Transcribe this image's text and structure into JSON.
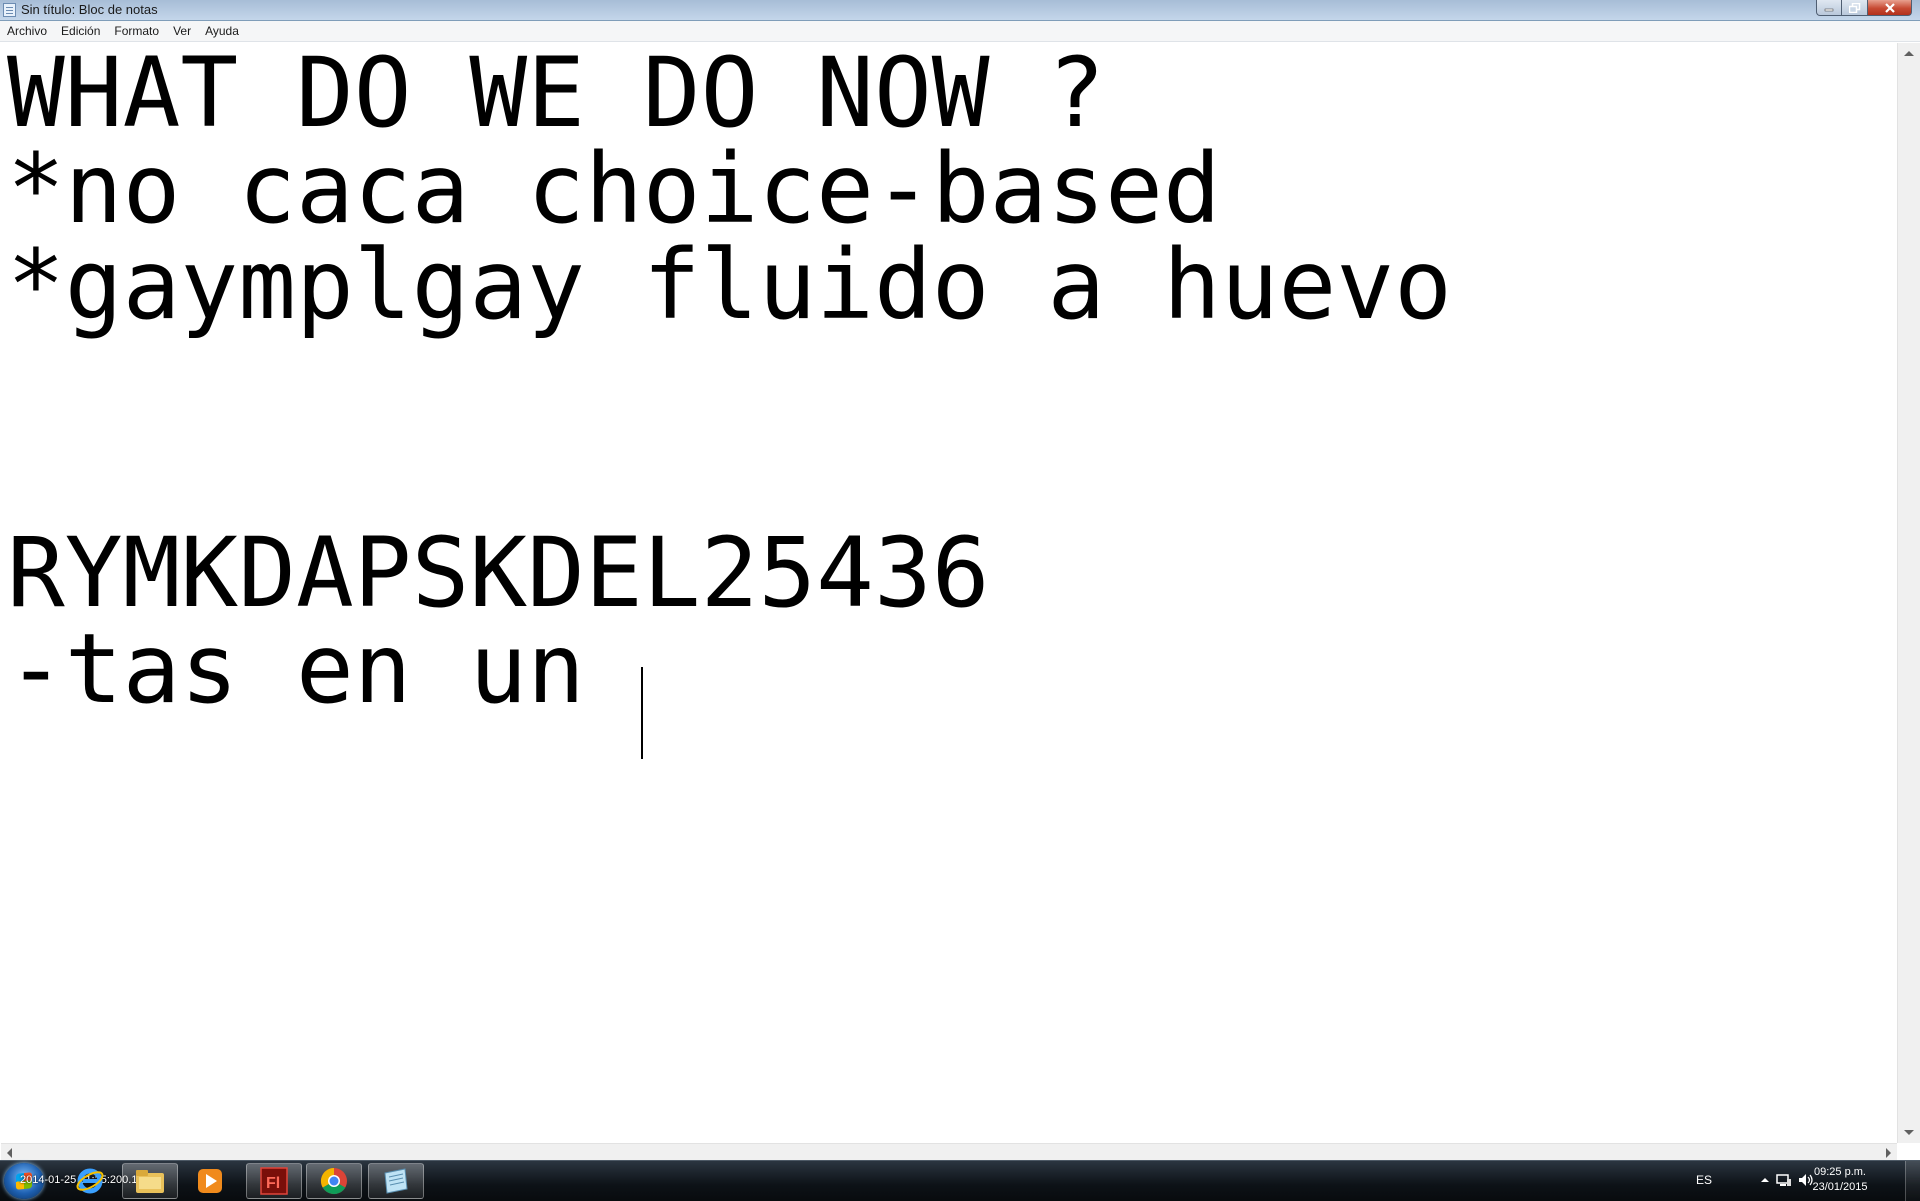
{
  "window": {
    "title": "Sin título: Bloc de notas"
  },
  "menu": [
    "Archivo",
    "Edición",
    "Formato",
    "Ver",
    "Ayuda"
  ],
  "document": {
    "lines": [
      "WHAT DO WE DO NOW ?",
      "*no caca choice-based",
      "*gaymplgay fluido a huevo",
      "",
      "",
      "RYMKDAPSKDEL25436",
      "-tas en un "
    ]
  },
  "taskbar": {
    "overlay_text": "2014-01-25 21:25:200.14",
    "pinned": [
      {
        "name": "Internet Explorer",
        "icon": "internet-explorer-icon"
      },
      {
        "name": "Windows Explorer",
        "icon": "folder-icon"
      },
      {
        "name": "Windows Media Player",
        "icon": "media-player-icon"
      },
      {
        "name": "Flash",
        "icon": "flash-icon"
      },
      {
        "name": "Chrome",
        "icon": "chrome-icon"
      },
      {
        "name": "Bloc de notas",
        "icon": "notepad-icon"
      }
    ],
    "language": "ES",
    "time": "09:25 p.m.",
    "date": "23/01/2015"
  },
  "colors": {
    "titlebar": "#b7cbe2",
    "taskbar": "#0d1217",
    "flash_red": "#b3221a"
  }
}
